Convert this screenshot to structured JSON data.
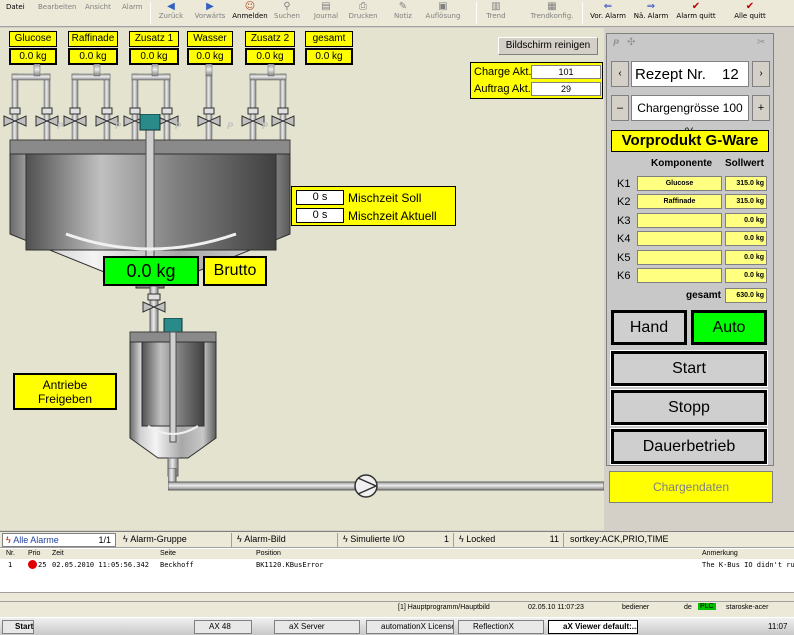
{
  "menu": {
    "datei": "Datei",
    "bearbeiten": "Bearbeiten",
    "ansicht": "Ansicht",
    "alarm": "Alarm"
  },
  "toolbar": {
    "zurueck": "Zurück",
    "vorwaerts": "Vorwärts",
    "anmelden": "Anmelden",
    "suchen": "Suchen",
    "journal": "Journal",
    "drucken": "Drucken",
    "notiz": "Notiz",
    "aufloesung": "Auflösung",
    "trend": "Trend",
    "trendkonfig": "Trendkonfig.",
    "vor_alarm": "Vor. Alarm",
    "nae_alarm": "Nä. Alarm",
    "alarm_quitt": "Alarm quitt",
    "alle_quitt": "Alle quitt"
  },
  "components": [
    {
      "label": "Glucose",
      "value": "0.0 kg"
    },
    {
      "label": "Raffinade",
      "value": "0.0 kg"
    },
    {
      "label": "Zusatz 1",
      "value": "0.0 kg"
    },
    {
      "label": "Wasser",
      "value": "0.0 kg"
    },
    {
      "label": "Zusatz 2",
      "value": "0.0 kg"
    },
    {
      "label": "gesamt",
      "value": "0.0 kg"
    }
  ],
  "screen_clean_button": "Bildschirm reinigen",
  "charge": {
    "charge_label": "Charge Akt.",
    "charge_value": "101",
    "auftrag_label": "Auftrag Akt.",
    "auftrag_value": "29"
  },
  "mix": {
    "soll_value": "0 s",
    "soll_label": "Mischzeit Soll",
    "aktuell_value": "0 s",
    "aktuell_label": "Mischzeit Aktuell"
  },
  "weight": {
    "value": "0.0 kg",
    "mode": "Brutto"
  },
  "drives_button": "Antriebe Freigeben",
  "panel": {
    "rezept_label": "Rezept Nr.",
    "rezept_value": "12",
    "chargengroesse": "Chargengrösse 100 %",
    "product": "Vorprodukt G-Ware",
    "col_komponente": "Komponente",
    "col_sollwert": "Sollwert",
    "rows": [
      {
        "k": "K1",
        "name": "Glucose",
        "value": "315.0 kg"
      },
      {
        "k": "K2",
        "name": "Raffinade",
        "value": "315.0 kg"
      },
      {
        "k": "K3",
        "name": "",
        "value": "0.0 kg"
      },
      {
        "k": "K4",
        "name": "",
        "value": "0.0 kg"
      },
      {
        "k": "K5",
        "name": "",
        "value": "0.0 kg"
      },
      {
        "k": "K6",
        "name": "",
        "value": "0.0 kg"
      }
    ],
    "gesamt_label": "gesamt",
    "gesamt_value": "630.0 kg",
    "hand": "Hand",
    "auto": "Auto",
    "start": "Start",
    "stopp": "Stopp",
    "dauerbetrieb": "Dauerbetrieb"
  },
  "chargendaten": "Chargendaten",
  "alarm": {
    "tabs": [
      {
        "label": "Alle Alarme",
        "count": "1/1"
      },
      {
        "label": "Alarm-Gruppe",
        "count": ""
      },
      {
        "label": "Alarm-Bild",
        "count": ""
      },
      {
        "label": "Simulierte I/O",
        "count": "1"
      },
      {
        "label": "Locked",
        "count": "11"
      }
    ],
    "sortkey": "sortkey:ACK,PRIO,TIME",
    "columns": {
      "nr": "Nr.",
      "prio": "Prio",
      "zeit": "Zeit",
      "seite": "Seite",
      "position": "Position",
      "anmerkung": "Anmerkung"
    },
    "rows": [
      {
        "nr": "1",
        "prio": "25",
        "zeit": "02.05.2010 11:05:56.342",
        "seite": "Beckhoff",
        "position": "BK1120.KBusError",
        "anmerkung": "The K-Bus IO didn't run"
      }
    ]
  },
  "status": {
    "screen": "[1] Hauptprogramm/Hauptbild",
    "time": "02.05.10 11:07:23",
    "user": "bediener",
    "lang": "de",
    "plc": "PLC",
    "host": "staroske-acer"
  },
  "taskbar": {
    "start": "Start",
    "tasks": [
      "AX 48",
      "aX Server",
      "automationX License ...",
      "ReflectionX",
      "aX Viewer default:..."
    ],
    "clock": "11:07"
  },
  "colors": {
    "yellow": "#ffff00",
    "green": "#00ff00",
    "process_bg": "#e3e3cf"
  }
}
